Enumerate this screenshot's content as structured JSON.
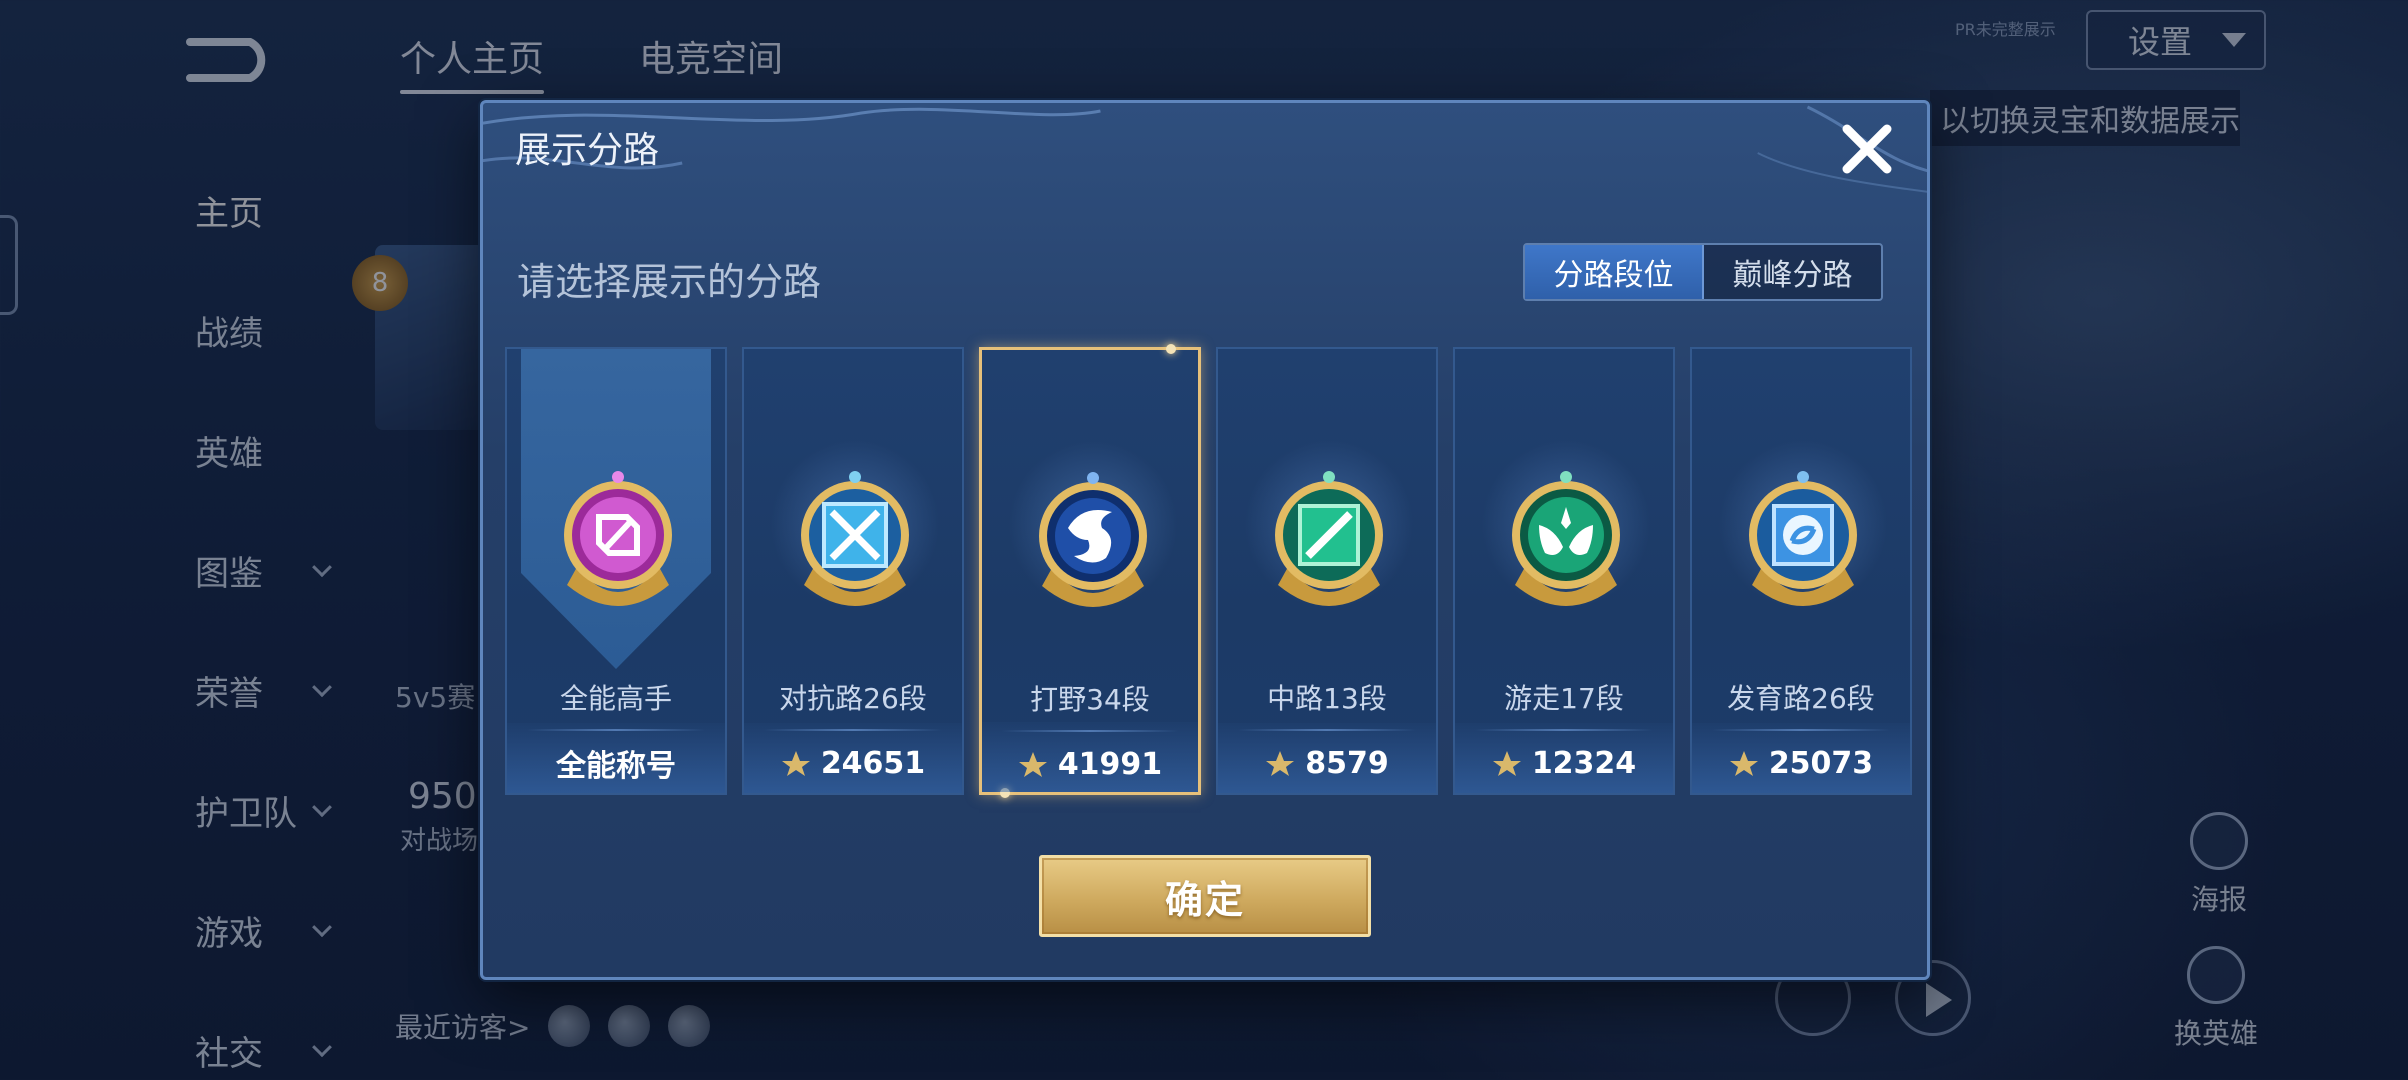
{
  "background": {
    "top_tabs": [
      {
        "label": "个人主页",
        "active": true
      },
      {
        "label": "电竞空间",
        "active": false
      }
    ],
    "settings_label": "设置",
    "small_hint": "PR未完整展示",
    "tip_banner": "以切换灵宝和数据展示",
    "nav": [
      {
        "label": "主页",
        "active": true,
        "expand": false
      },
      {
        "label": "战绩",
        "active": false,
        "expand": false
      },
      {
        "label": "英雄",
        "active": false,
        "expand": false
      },
      {
        "label": "图鉴",
        "active": false,
        "expand": true
      },
      {
        "label": "荣誉",
        "active": false,
        "expand": true
      },
      {
        "label": "护卫队",
        "active": false,
        "expand": true
      },
      {
        "label": "游戏",
        "active": false,
        "expand": true
      },
      {
        "label": "社交",
        "active": false,
        "expand": true
      }
    ],
    "level": "8",
    "mode_label": "5v5赛",
    "stat_number": "950",
    "stat_label": "对战场",
    "visitors_label": "最近访客>",
    "right_buttons": {
      "poster": "海报",
      "change_hero": "换英雄"
    }
  },
  "modal": {
    "title": "展示分路",
    "subtitle": "请选择展示的分路",
    "toggle": [
      {
        "label": "分路段位",
        "selected": true
      },
      {
        "label": "巅峰分路",
        "selected": false
      }
    ],
    "cards": [
      {
        "name": "全能高手",
        "value": "全能称号",
        "icon": "all-round-emblem",
        "color": "#c73fc3",
        "selected": false,
        "points_icon": false
      },
      {
        "name": "对抗路26段",
        "value": "24651",
        "icon": "clash-lane-emblem",
        "color": "#3aa8e6",
        "selected": false,
        "points_icon": true
      },
      {
        "name": "打野34段",
        "value": "41991",
        "icon": "jungle-emblem",
        "color": "#2a6fd6",
        "selected": true,
        "points_icon": true
      },
      {
        "name": "中路13段",
        "value": "8579",
        "icon": "mid-lane-emblem",
        "color": "#1fb58a",
        "selected": false,
        "points_icon": true
      },
      {
        "name": "游走17段",
        "value": "12324",
        "icon": "roam-emblem",
        "color": "#1fa070",
        "selected": false,
        "points_icon": true
      },
      {
        "name": "发育路26段",
        "value": "25073",
        "icon": "farm-lane-emblem",
        "color": "#3b8fe0",
        "selected": false,
        "points_icon": true
      }
    ],
    "confirm_label": "确定"
  }
}
